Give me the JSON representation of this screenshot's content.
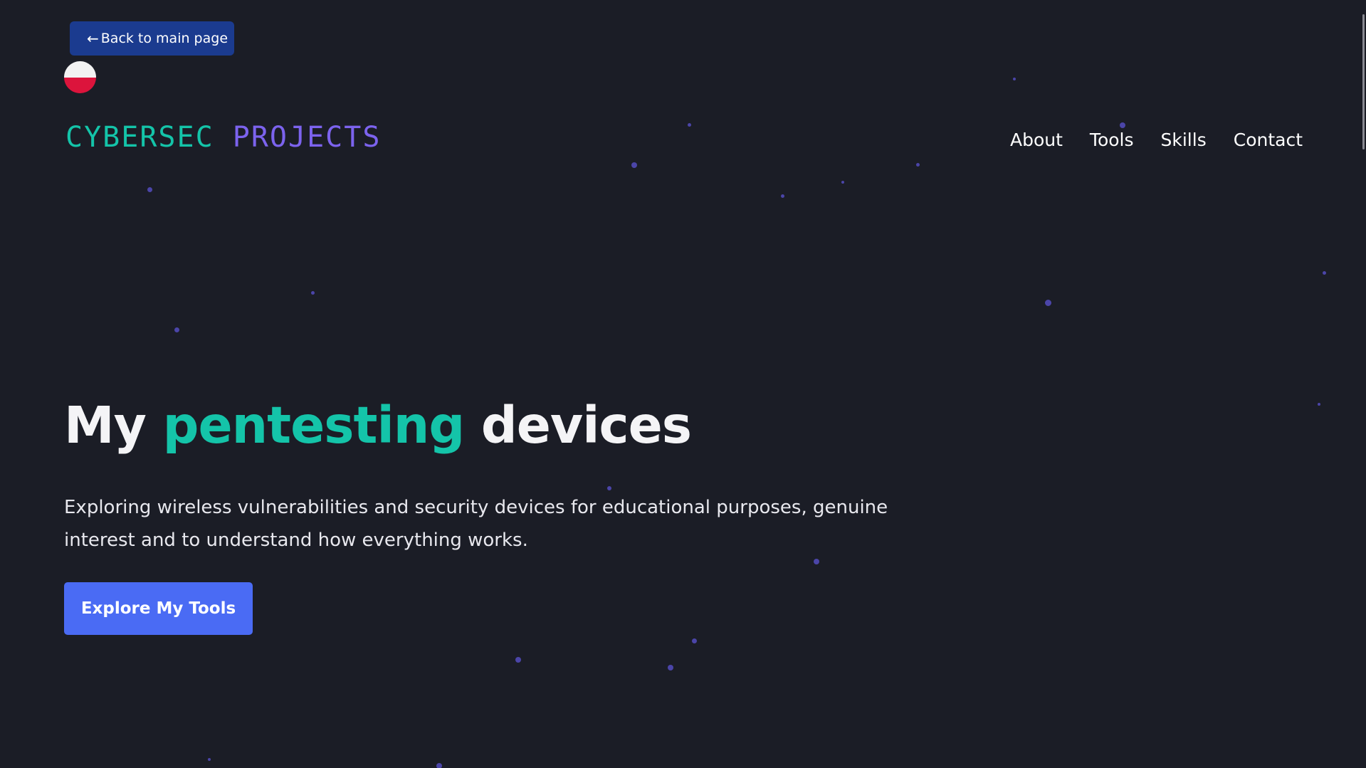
{
  "back_button": {
    "arrow": "←",
    "label": "Back to main page"
  },
  "language_flag": {
    "icon": "poland-flag-icon",
    "colors": [
      "#f2f2f2",
      "#dc143c"
    ]
  },
  "logo": {
    "part1": "CYBERSEC",
    "part2": "PROJECTS"
  },
  "nav": {
    "items": [
      "About",
      "Tools",
      "Skills",
      "Contact"
    ]
  },
  "hero": {
    "title_part1": "My",
    "title_highlight": "pentesting",
    "title_part2": "devices",
    "subtitle_line1": "Exploring wireless vulnerabilities and security devices for educational purposes, genuine",
    "subtitle_line2": "interest and to understand how everything works.",
    "cta_label": "Explore My Tools"
  },
  "colors": {
    "background": "#1b1d26",
    "accent_teal": "#14c4a9",
    "accent_purple": "#7c63ee",
    "cta_blue": "#4a6bf4",
    "back_button_blue": "#1b3b8f",
    "particle": "#4b45a8"
  }
}
